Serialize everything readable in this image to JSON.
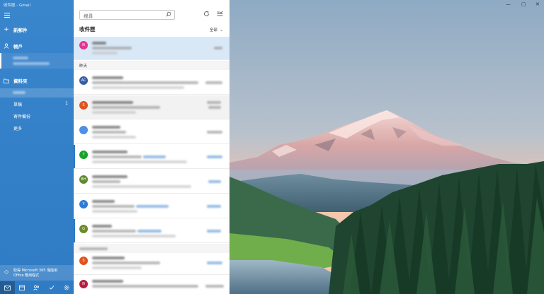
{
  "window": {
    "title": "收件匣 - Gmail",
    "minimize": "—",
    "maximize": "▢",
    "close": "✕"
  },
  "sidebar": {
    "menu_icon": "hamburger-icon",
    "new_mail": "新郵件",
    "accounts": "帳戶",
    "folders": "資料夾",
    "folder_items": [
      {
        "label": "草稿",
        "count": "1"
      },
      {
        "label": "寄件備份",
        "count": ""
      },
      {
        "label": "更多",
        "count": ""
      }
    ],
    "promo_line1": "取得 Microsoft 365 僅能用",
    "promo_line2": "Office 應用程式"
  },
  "list": {
    "search_placeholder": "搜尋",
    "title": "收件匣",
    "filter": "全部",
    "sections": {
      "yesterday": "昨天"
    },
    "avatars": [
      {
        "letter": "N",
        "color": "#e3358f"
      },
      {
        "letter": "AC",
        "color": "#365ea6"
      },
      {
        "letter": "S",
        "color": "#e0531f"
      },
      {
        "letter": "",
        "color": "#4f8fe8"
      },
      {
        "letter": "T",
        "color": "#1aa32c"
      },
      {
        "letter": "BH",
        "color": "#5f8a2c"
      },
      {
        "letter": "Y",
        "color": "#2f7cd8"
      },
      {
        "letter": "G",
        "color": "#6e8b2a"
      },
      {
        "letter": "S",
        "color": "#e0531f"
      },
      {
        "letter": "N",
        "color": "#b51f42"
      }
    ]
  }
}
